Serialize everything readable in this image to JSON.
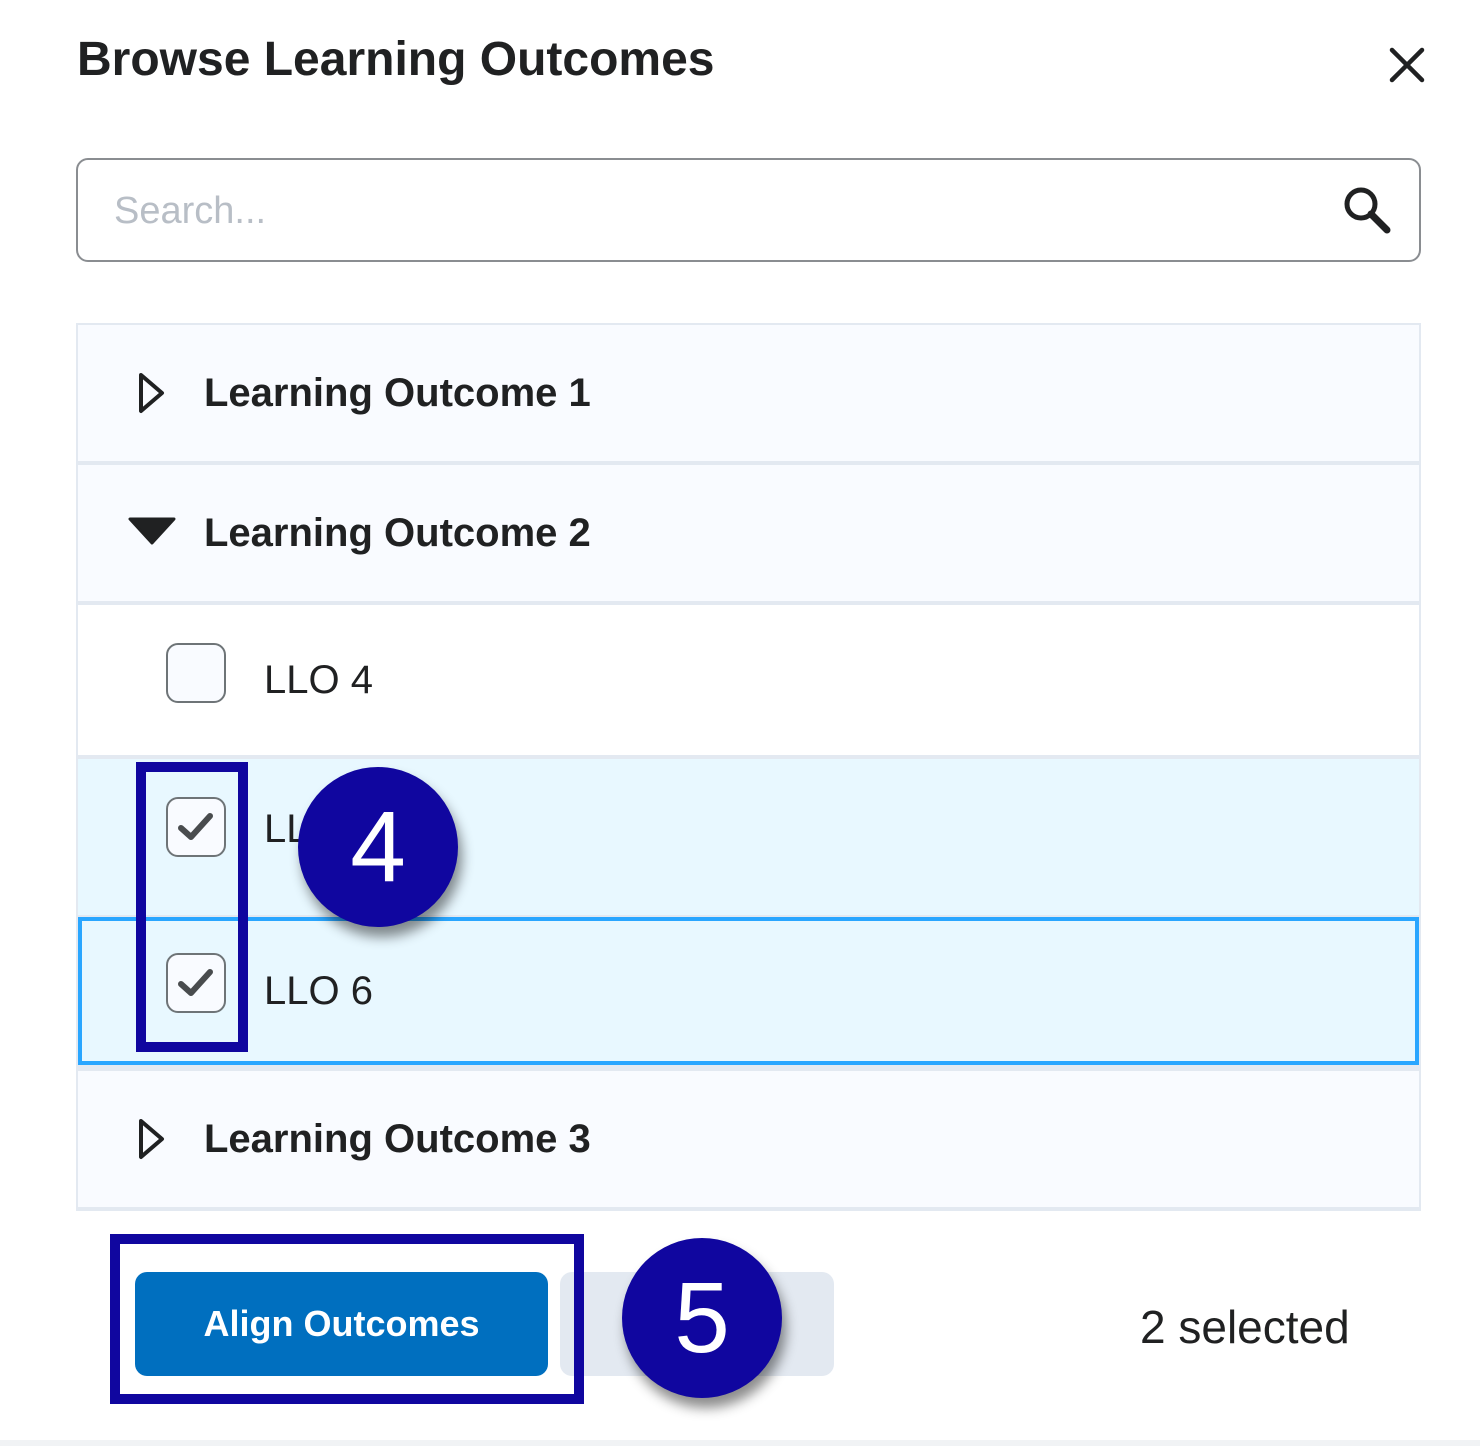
{
  "dialog": {
    "title": "Browse Learning Outcomes",
    "close_icon": "close-icon"
  },
  "search": {
    "placeholder": "Search...",
    "value": "",
    "icon": "search-icon"
  },
  "outcomes": [
    {
      "label": "Learning Outcome 1",
      "expanded": false
    },
    {
      "label": "Learning Outcome 2",
      "expanded": true,
      "children": [
        {
          "label": "LLO 4",
          "checked": false
        },
        {
          "label": "LLO 5",
          "checked": true
        },
        {
          "label": "LLO 6",
          "checked": true,
          "focused": true
        }
      ]
    },
    {
      "label": "Learning Outcome 3",
      "expanded": false
    }
  ],
  "footer": {
    "align_label": "Align Outcomes",
    "cancel_label": "",
    "selected_count": "2 selected"
  },
  "annotations": {
    "step4": "4",
    "step5": "5"
  },
  "colors": {
    "primary": "#006fbf",
    "annotation": "#10069f",
    "selected_row": "#e8f8ff",
    "focus_border": "#29a6ff"
  }
}
